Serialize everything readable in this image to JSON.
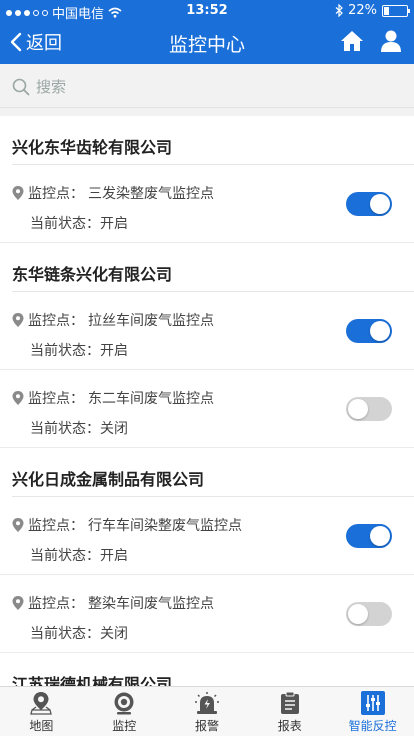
{
  "statusbar": {
    "carrier": "中国电信",
    "time": "13:52",
    "battery": "22%"
  },
  "navbar": {
    "back_label": "返回",
    "title": "监控中心"
  },
  "search": {
    "placeholder": "搜索"
  },
  "labels": {
    "point_prefix": "监控点：",
    "status_prefix": "当前状态："
  },
  "companies": [
    {
      "name": "兴化东华齿轮有限公司",
      "points": [
        {
          "name": "三发染整废气监控点",
          "status": "开启",
          "on": true
        }
      ]
    },
    {
      "name": "东华链条兴化有限公司",
      "points": [
        {
          "name": "拉丝车间废气监控点",
          "status": "开启",
          "on": true
        },
        {
          "name": "东二车间废气监控点",
          "status": "关闭",
          "on": false
        }
      ]
    },
    {
      "name": "兴化日成金属制品有限公司",
      "points": [
        {
          "name": "行车车间染整废气监控点",
          "status": "开启",
          "on": true
        },
        {
          "name": "整染车间废气监控点",
          "status": "关闭",
          "on": false
        }
      ]
    },
    {
      "name": "江苏瑞德机械有限公司",
      "points": []
    }
  ],
  "tabs": [
    {
      "label": "地图",
      "icon": "map-pin-icon"
    },
    {
      "label": "监控",
      "icon": "camera-icon"
    },
    {
      "label": "报警",
      "icon": "alarm-icon"
    },
    {
      "label": "报表",
      "icon": "report-icon"
    },
    {
      "label": "智能反控",
      "icon": "sliders-icon",
      "active": true
    }
  ],
  "colors": {
    "primary": "#1a6fd8",
    "toggle_off": "#d3d3d3"
  }
}
